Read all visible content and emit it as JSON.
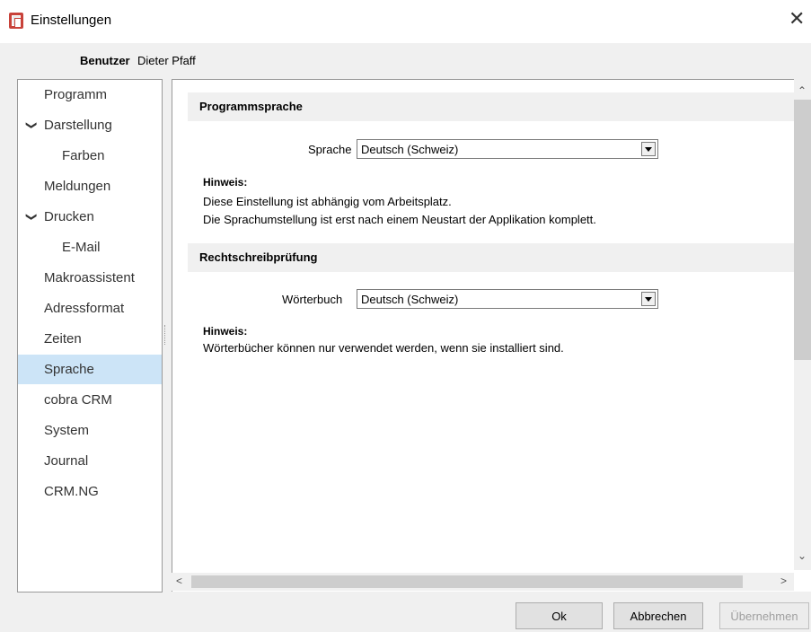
{
  "window": {
    "title": "Einstellungen",
    "close_icon": "close-icon"
  },
  "user": {
    "label": "Benutzer",
    "name": "Dieter Pfaff"
  },
  "sidebar": {
    "items": [
      {
        "label": "Programm",
        "level": 0,
        "expander": ""
      },
      {
        "label": "Darstellung",
        "level": 0,
        "expander": "expanded"
      },
      {
        "label": "Farben",
        "level": 1,
        "expander": ""
      },
      {
        "label": "Meldungen",
        "level": 0,
        "expander": ""
      },
      {
        "label": "Drucken",
        "level": 0,
        "expander": "expanded"
      },
      {
        "label": "E-Mail",
        "level": 1,
        "expander": ""
      },
      {
        "label": "Makroassistent",
        "level": 0,
        "expander": ""
      },
      {
        "label": "Adressformat",
        "level": 0,
        "expander": ""
      },
      {
        "label": "Zeiten",
        "level": 0,
        "expander": ""
      },
      {
        "label": "Sprache",
        "level": 0,
        "expander": "",
        "selected": true
      },
      {
        "label": "cobra CRM",
        "level": 0,
        "expander": ""
      },
      {
        "label": "System",
        "level": 0,
        "expander": ""
      },
      {
        "label": "Journal",
        "level": 0,
        "expander": ""
      },
      {
        "label": "CRM.NG",
        "level": 0,
        "expander": ""
      }
    ]
  },
  "main": {
    "programmsprache": {
      "header": "Programmsprache",
      "field_label": "Sprache",
      "value": "Deutsch (Schweiz)",
      "hint_title": "Hinweis:",
      "hint_line1": "Diese Einstellung ist abhängig vom Arbeitsplatz.",
      "hint_line2": "Die Sprachumstellung ist erst nach einem Neustart der Applikation komplett."
    },
    "rechtschreibung": {
      "header": "Rechtschreibprüfung",
      "field_label": "Wörterbuch",
      "value": "Deutsch (Schweiz)",
      "hint_title": "Hinweis:",
      "hint_line1": "Wörterbücher können nur verwendet werden, wenn sie installiert sind."
    }
  },
  "buttons": {
    "ok": "Ok",
    "cancel": "Abbrechen",
    "apply": "Übernehmen"
  }
}
